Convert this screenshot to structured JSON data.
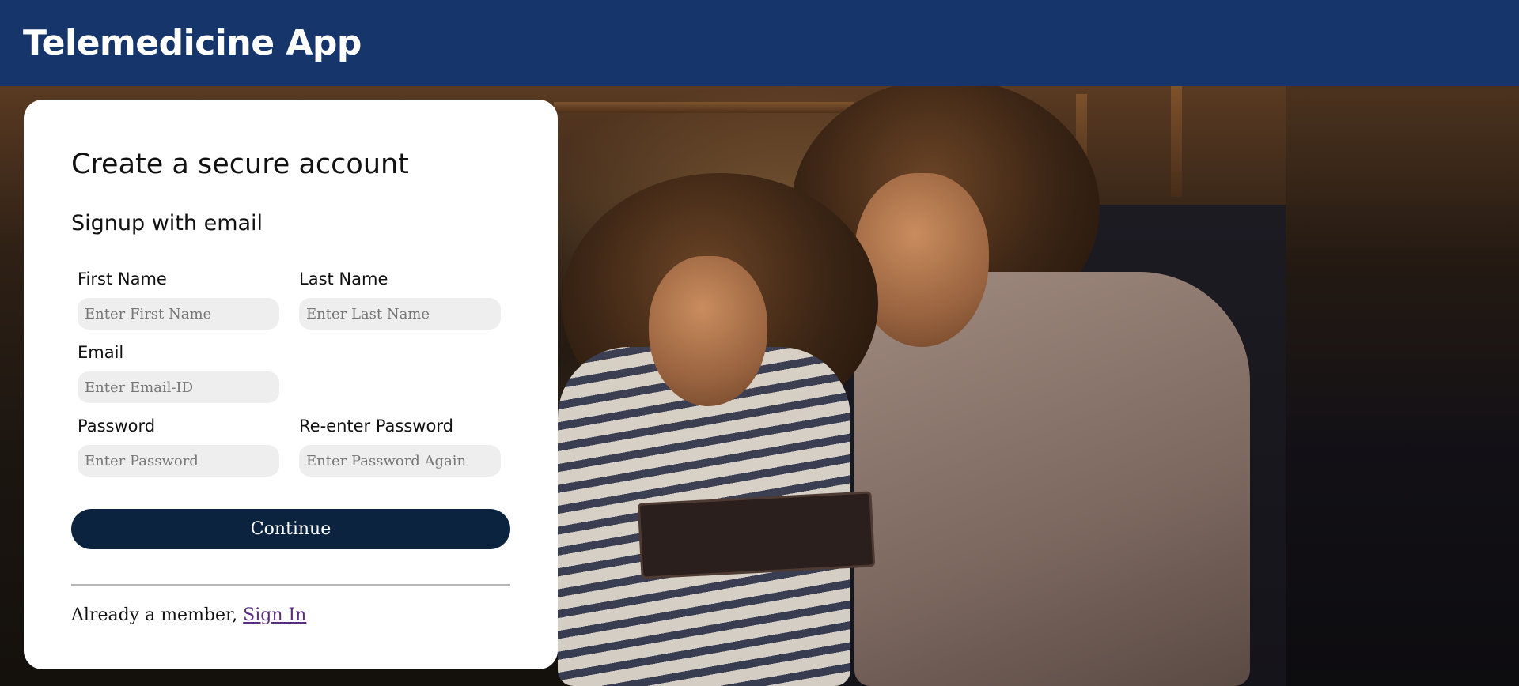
{
  "header": {
    "title": "Telemedicine App",
    "background_color": "#16366b"
  },
  "hero": {
    "image_description_icon": "photo-mother-daughter-tablet"
  },
  "signup_card": {
    "title": "Create a secure account",
    "subtitle": "Signup with email",
    "fields": {
      "first_name": {
        "label": "First Name",
        "placeholder": "Enter First Name",
        "value": ""
      },
      "last_name": {
        "label": "Last Name",
        "placeholder": "Enter Last Name",
        "value": ""
      },
      "email": {
        "label": "Email",
        "placeholder": "Enter Email-ID",
        "value": ""
      },
      "password": {
        "label": "Password",
        "placeholder": "Enter Password",
        "value": ""
      },
      "reenter_password": {
        "label": "Re-enter Password",
        "placeholder": "Enter Password Again",
        "value": ""
      }
    },
    "continue_label": "Continue",
    "continue_color": "#0c2340",
    "member_prompt": "Already a member,",
    "sign_in_label": "Sign In",
    "sign_in_color": "#5a2d82"
  }
}
